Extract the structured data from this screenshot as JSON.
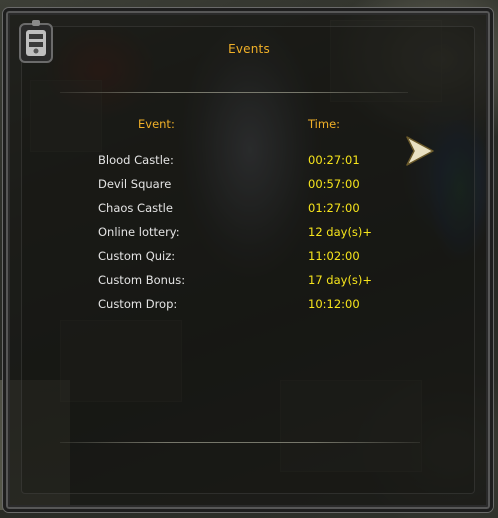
{
  "window": {
    "title": "Events"
  },
  "table": {
    "columns": {
      "event": "Event:",
      "time": "Time:"
    },
    "rows": [
      {
        "event": "Blood Castle:",
        "time": "00:27:01"
      },
      {
        "event": "Devil Square",
        "time": "00:57:00"
      },
      {
        "event": "Chaos Castle",
        "time": "01:27:00"
      },
      {
        "event": "Online lottery:",
        "time": "12 day(s)+"
      },
      {
        "event": "Custom Quiz:",
        "time": "11:02:00"
      },
      {
        "event": "Custom Bonus:",
        "time": "17 day(s)+"
      },
      {
        "event": "Custom Drop:",
        "time": "10:12:00"
      }
    ]
  },
  "colors": {
    "header": "#f0b028",
    "event_name": "#e4e4e4",
    "time_value": "#f7e51c",
    "frame": "#575757"
  },
  "icons": {
    "corner_emblem": "lantern-emblem-icon",
    "cursor": "arrow-cursor-icon"
  }
}
